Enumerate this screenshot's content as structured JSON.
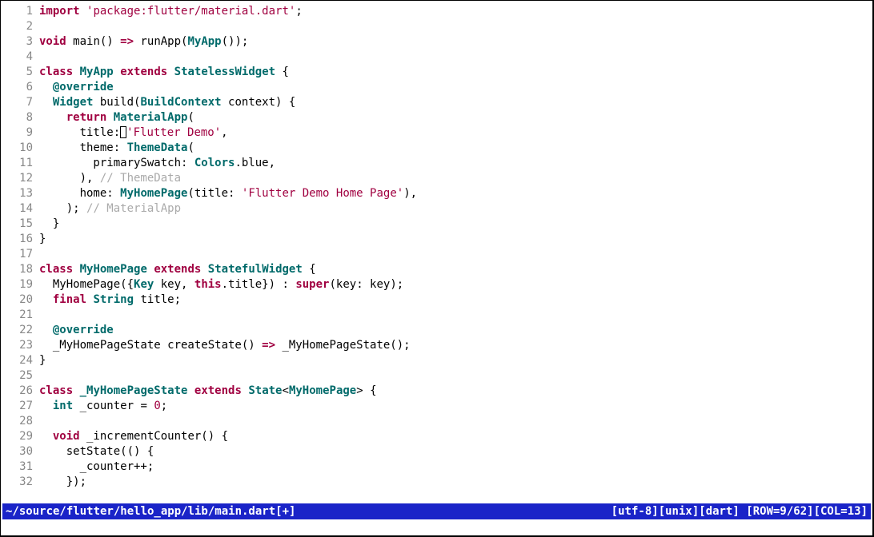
{
  "status": {
    "file": "~/source/flutter/hello_app/lib/main.dart[+]",
    "encoding": "[utf-8]",
    "fileformat": "[unix]",
    "filetype": "[dart]",
    "position": "[ROW=9/62][COL=13]"
  },
  "cursor": {
    "row": 9,
    "col": 13
  },
  "lines": [
    {
      "n": 1,
      "tokens": [
        [
          "kw",
          "import"
        ],
        [
          "op",
          " "
        ],
        [
          "str",
          "'package:flutter/material.dart'"
        ],
        [
          "op",
          ";"
        ]
      ]
    },
    {
      "n": 2,
      "tokens": []
    },
    {
      "n": 3,
      "tokens": [
        [
          "kw",
          "void"
        ],
        [
          "op",
          " "
        ],
        [
          "id",
          "main"
        ],
        [
          "op",
          "() "
        ],
        [
          "kw",
          "=>"
        ],
        [
          "op",
          " runApp("
        ],
        [
          "typ",
          "MyApp"
        ],
        [
          "op",
          "());"
        ]
      ]
    },
    {
      "n": 4,
      "tokens": []
    },
    {
      "n": 5,
      "tokens": [
        [
          "kw",
          "class"
        ],
        [
          "op",
          " "
        ],
        [
          "typ",
          "MyApp"
        ],
        [
          "op",
          " "
        ],
        [
          "kw",
          "extends"
        ],
        [
          "op",
          " "
        ],
        [
          "typ",
          "StatelessWidget"
        ],
        [
          "op",
          " {"
        ]
      ]
    },
    {
      "n": 6,
      "tokens": [
        [
          "op",
          "  "
        ],
        [
          "ann",
          "@override"
        ]
      ]
    },
    {
      "n": 7,
      "tokens": [
        [
          "op",
          "  "
        ],
        [
          "typ",
          "Widget"
        ],
        [
          "op",
          " build("
        ],
        [
          "typ",
          "BuildContext"
        ],
        [
          "op",
          " context) {"
        ]
      ]
    },
    {
      "n": 8,
      "tokens": [
        [
          "op",
          "    "
        ],
        [
          "kw",
          "return"
        ],
        [
          "op",
          " "
        ],
        [
          "typ",
          "MaterialApp"
        ],
        [
          "op",
          "("
        ]
      ]
    },
    {
      "n": 9,
      "tokens": [
        [
          "op",
          "      title:"
        ],
        [
          "cursor",
          ""
        ],
        [
          "str",
          "'Flutter Demo'"
        ],
        [
          "op",
          ","
        ]
      ]
    },
    {
      "n": 10,
      "tokens": [
        [
          "op",
          "      theme: "
        ],
        [
          "typ",
          "ThemeData"
        ],
        [
          "op",
          "("
        ]
      ]
    },
    {
      "n": 11,
      "tokens": [
        [
          "op",
          "        primarySwatch: "
        ],
        [
          "typ",
          "Colors"
        ],
        [
          "op",
          ".blue,"
        ]
      ]
    },
    {
      "n": 12,
      "tokens": [
        [
          "op",
          "      ), "
        ],
        [
          "cmt",
          "// ThemeData"
        ]
      ]
    },
    {
      "n": 13,
      "tokens": [
        [
          "op",
          "      home: "
        ],
        [
          "typ",
          "MyHomePage"
        ],
        [
          "op",
          "(title: "
        ],
        [
          "str",
          "'Flutter Demo Home Page'"
        ],
        [
          "op",
          "),"
        ]
      ]
    },
    {
      "n": 14,
      "tokens": [
        [
          "op",
          "    ); "
        ],
        [
          "cmt",
          "// MaterialApp"
        ]
      ]
    },
    {
      "n": 15,
      "tokens": [
        [
          "op",
          "  }"
        ]
      ]
    },
    {
      "n": 16,
      "tokens": [
        [
          "op",
          "}"
        ]
      ]
    },
    {
      "n": 17,
      "tokens": []
    },
    {
      "n": 18,
      "tokens": [
        [
          "kw",
          "class"
        ],
        [
          "op",
          " "
        ],
        [
          "typ",
          "MyHomePage"
        ],
        [
          "op",
          " "
        ],
        [
          "kw",
          "extends"
        ],
        [
          "op",
          " "
        ],
        [
          "typ",
          "StatefulWidget"
        ],
        [
          "op",
          " {"
        ]
      ]
    },
    {
      "n": 19,
      "tokens": [
        [
          "op",
          "  MyHomePage({"
        ],
        [
          "typ",
          "Key"
        ],
        [
          "op",
          " key, "
        ],
        [
          "thiskw",
          "this"
        ],
        [
          "op",
          ".title}) : "
        ],
        [
          "kw",
          "super"
        ],
        [
          "op",
          "(key: key);"
        ]
      ]
    },
    {
      "n": 20,
      "tokens": [
        [
          "op",
          "  "
        ],
        [
          "kw",
          "final"
        ],
        [
          "op",
          " "
        ],
        [
          "typ",
          "String"
        ],
        [
          "op",
          " title;"
        ]
      ]
    },
    {
      "n": 21,
      "tokens": []
    },
    {
      "n": 22,
      "tokens": [
        [
          "op",
          "  "
        ],
        [
          "ann",
          "@override"
        ]
      ]
    },
    {
      "n": 23,
      "tokens": [
        [
          "op",
          "  _MyHomePageState createState() "
        ],
        [
          "kw",
          "=>"
        ],
        [
          "op",
          " _MyHomePageState();"
        ]
      ]
    },
    {
      "n": 24,
      "tokens": [
        [
          "op",
          "}"
        ]
      ]
    },
    {
      "n": 25,
      "tokens": []
    },
    {
      "n": 26,
      "tokens": [
        [
          "kw",
          "class"
        ],
        [
          "op",
          " "
        ],
        [
          "typ",
          "_MyHomePageState"
        ],
        [
          "op",
          " "
        ],
        [
          "kw",
          "extends"
        ],
        [
          "op",
          " "
        ],
        [
          "typ",
          "State"
        ],
        [
          "op",
          "<"
        ],
        [
          "typ",
          "MyHomePage"
        ],
        [
          "op",
          "> {"
        ]
      ]
    },
    {
      "n": 27,
      "tokens": [
        [
          "op",
          "  "
        ],
        [
          "typ",
          "int"
        ],
        [
          "op",
          " _counter = "
        ],
        [
          "num",
          "0"
        ],
        [
          "op",
          ";"
        ]
      ]
    },
    {
      "n": 28,
      "tokens": []
    },
    {
      "n": 29,
      "tokens": [
        [
          "op",
          "  "
        ],
        [
          "kw",
          "void"
        ],
        [
          "op",
          " _incrementCounter() {"
        ]
      ]
    },
    {
      "n": 30,
      "tokens": [
        [
          "op",
          "    setState(() {"
        ]
      ]
    },
    {
      "n": 31,
      "tokens": [
        [
          "op",
          "      _counter++;"
        ]
      ]
    },
    {
      "n": 32,
      "tokens": [
        [
          "op",
          "    });"
        ]
      ]
    }
  ]
}
